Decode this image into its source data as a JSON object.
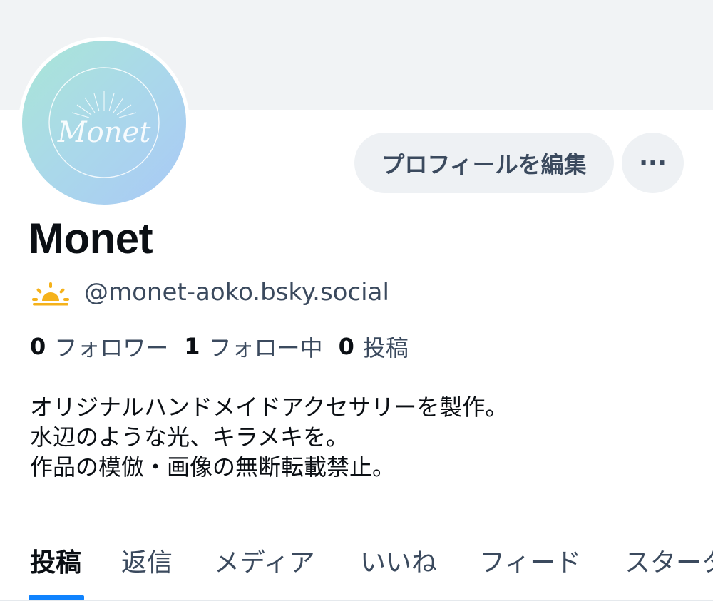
{
  "profile": {
    "display_name": "Monet",
    "handle": "@monet-aoko.bsky.social",
    "avatar_text": "Monet"
  },
  "actions": {
    "edit_profile_label": "プロフィールを編集",
    "more_label": "···"
  },
  "stats": {
    "followers_count": "0",
    "followers_label": "フォロワー",
    "following_count": "1",
    "following_label": "フォロー中",
    "posts_count": "0",
    "posts_label": "投稿"
  },
  "bio": {
    "line1": "オリジナルハンドメイドアクセサリーを製作。",
    "line2": "水辺のような光、キラメキを。",
    "line3": "作品の模倣・画像の無断転載禁止。"
  },
  "tabs": [
    {
      "label": "投稿",
      "active": true
    },
    {
      "label": "返信",
      "active": false
    },
    {
      "label": "メディア",
      "active": false
    },
    {
      "label": "いいね",
      "active": false
    },
    {
      "label": "フィード",
      "active": false
    },
    {
      "label": "スターター",
      "active": false
    }
  ],
  "colors": {
    "accent": "#1083fe",
    "muted_text": "#3b4a5e",
    "button_bg": "#eef1f4",
    "banner_bg": "#f1f3f5",
    "sun_icon": "#f5b21b"
  },
  "icons": {
    "handle_prefix_icon": "sunrise-icon",
    "more_icon": "ellipsis-icon"
  }
}
